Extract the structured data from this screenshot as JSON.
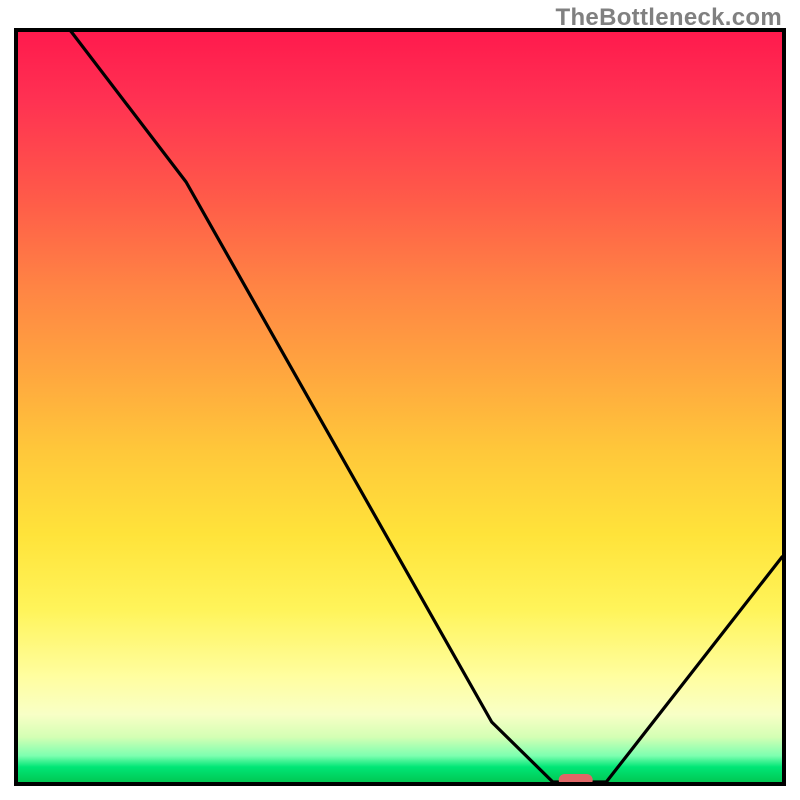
{
  "watermark": "TheBottleneck.com",
  "colors": {
    "frame": "#000000",
    "curve": "#000000",
    "marker": "#e06666",
    "gradient_top": "#ff1a4d",
    "gradient_bottom": "#00c853"
  },
  "chart_data": {
    "type": "line",
    "title": "",
    "xlabel": "",
    "ylabel": "",
    "xlim": [
      0,
      100
    ],
    "ylim": [
      0,
      100
    ],
    "x": [
      0,
      7,
      22,
      62,
      70,
      77,
      100
    ],
    "values": [
      110,
      100,
      80,
      8,
      0,
      0,
      30
    ],
    "marker_x": 73,
    "marker_y": 0,
    "notes": "Background encodes a value gradient from high (red, top) to low (green, bottom). The black curve descends steeply from upper-left, reaches a minimum around x≈70-77 (flat at y≈0), then rises toward the right. A small red marker sits on the flat minimum near x≈73."
  }
}
